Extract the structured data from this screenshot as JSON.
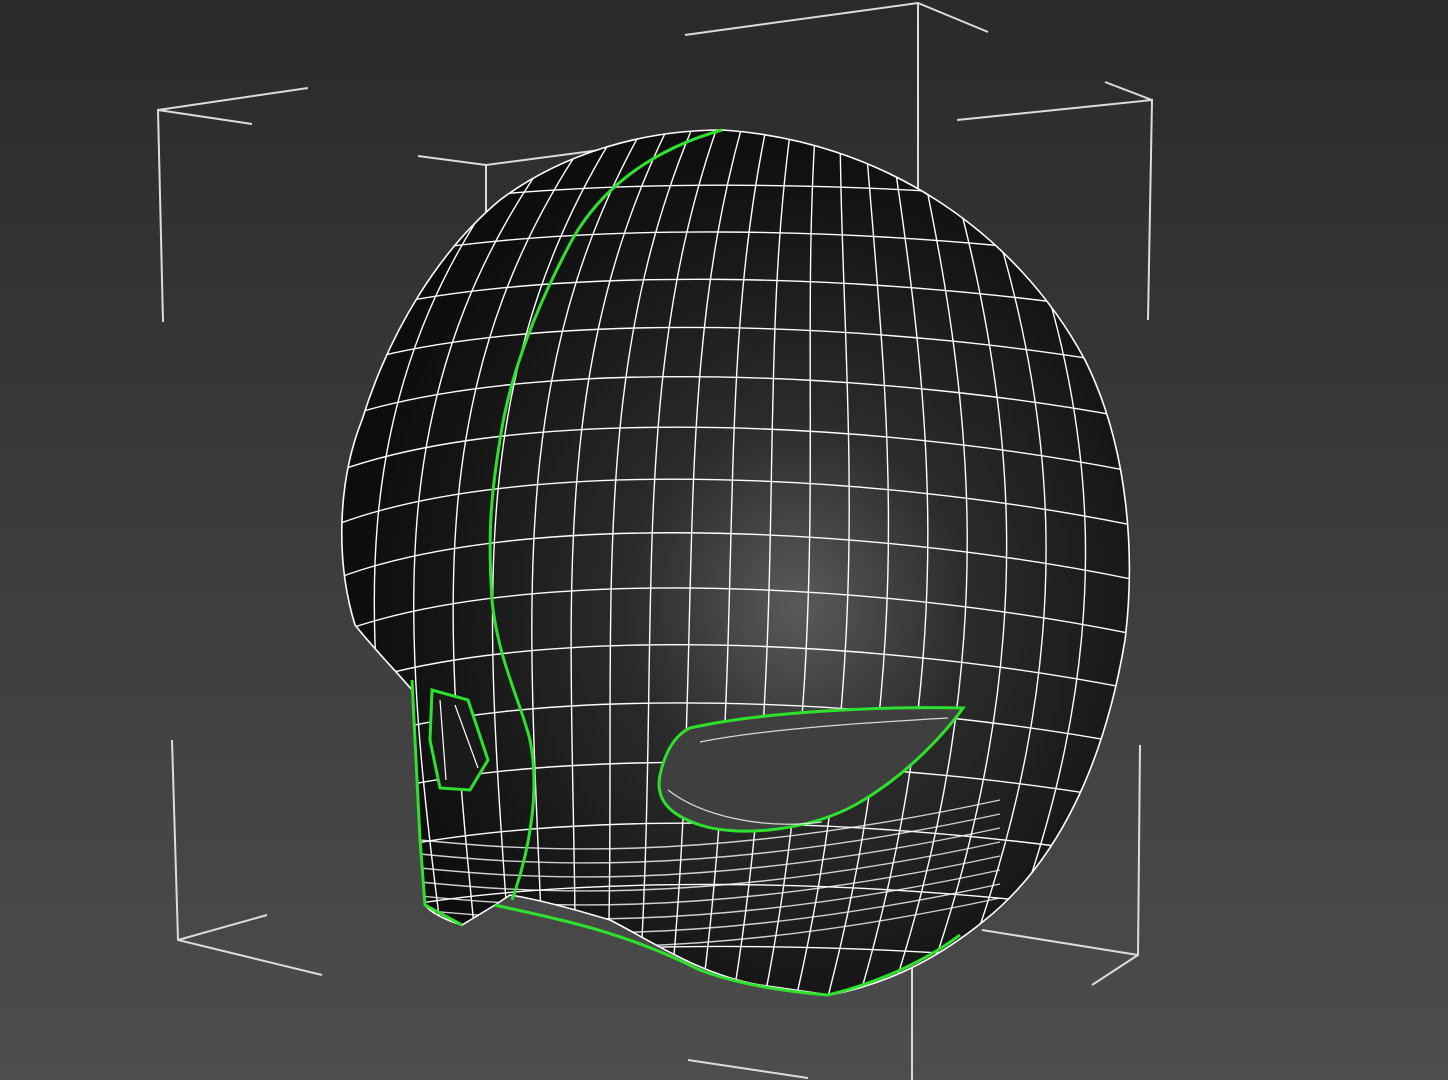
{
  "viewport": {
    "name": "3d-perspective-viewport",
    "background_top": "#2a2a2a",
    "background_bottom": "#4d4d4d"
  },
  "model": {
    "object": "helmet-mask-mesh",
    "shading": "smooth-dark",
    "wireframe_color": "#ffffff",
    "selected_edge_color": "#2fe02f",
    "bounding_box_color": "#dcdcdc"
  }
}
